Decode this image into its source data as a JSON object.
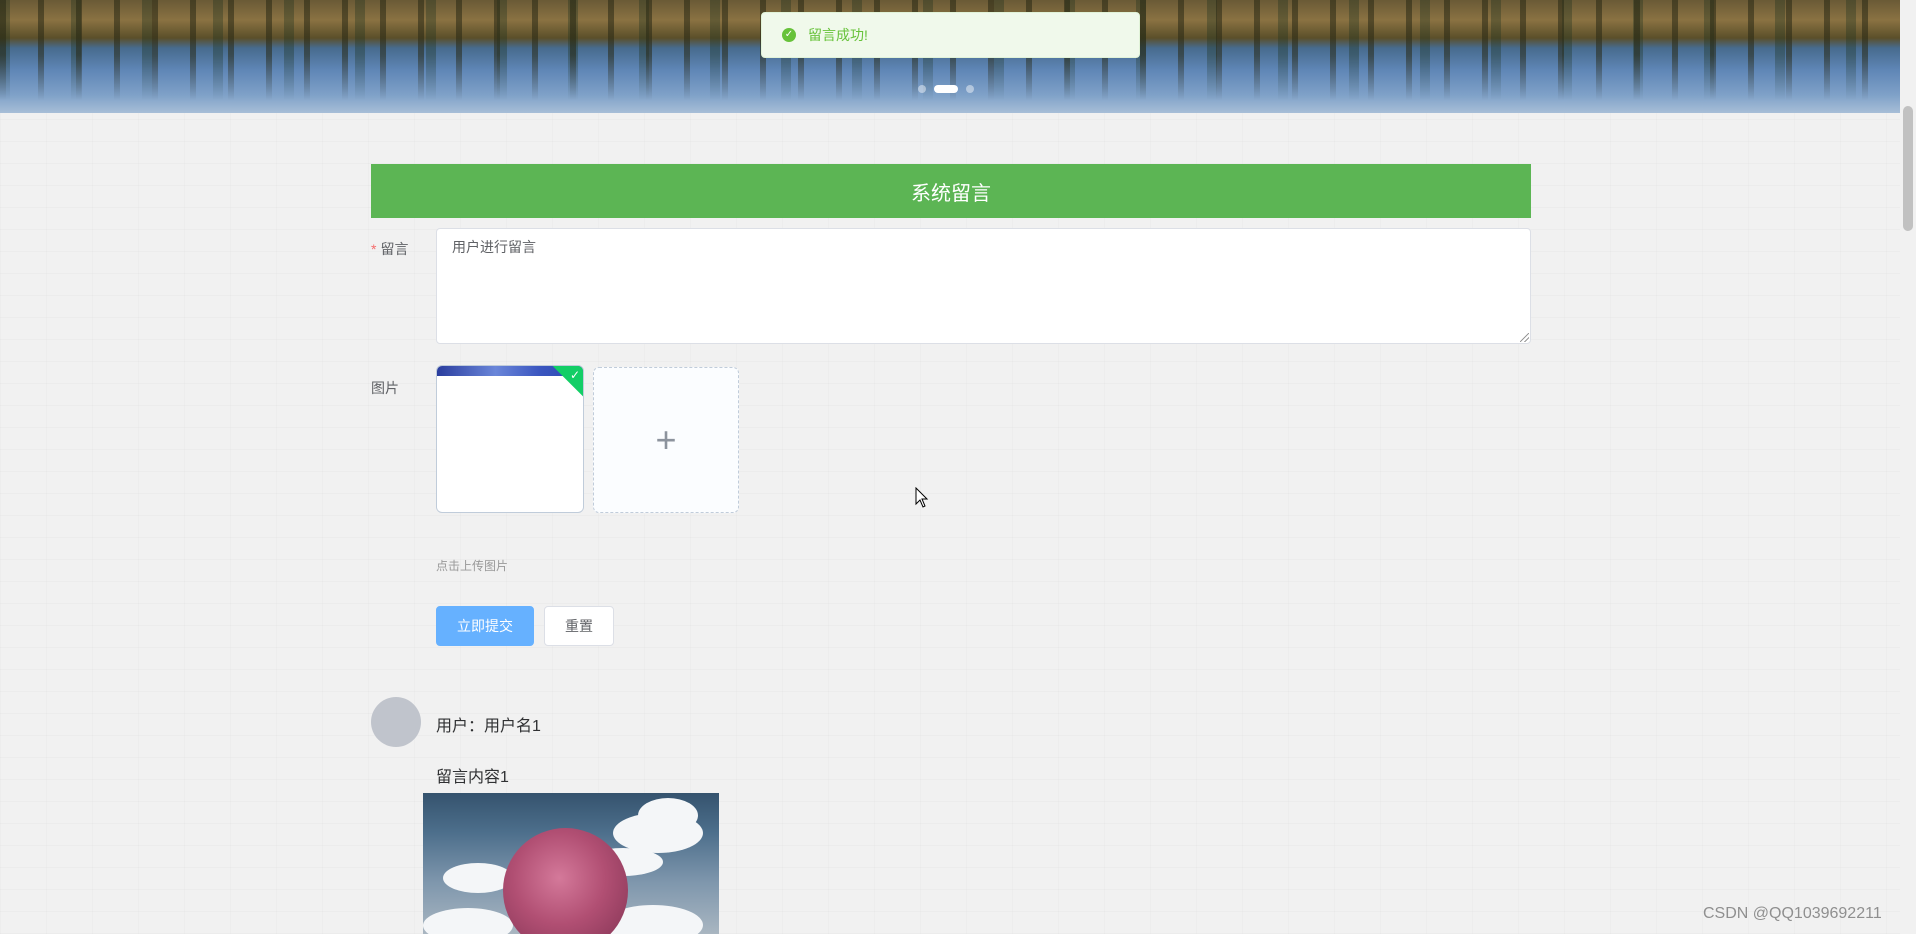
{
  "toast": {
    "icon": "check-circle-icon",
    "message": "留言成功!"
  },
  "carousel": {
    "slides": 3,
    "active_index": 1
  },
  "section": {
    "title": "系统留言"
  },
  "form": {
    "message_label": "留言",
    "message_required_mark": "*",
    "message_value": "用户进行留言",
    "image_label": "图片",
    "upload_tip": "点击上传图片",
    "submit_label": "立即提交",
    "reset_label": "重置"
  },
  "messages": [
    {
      "user_text": "用户：用户名1",
      "content": "留言内容1"
    }
  ],
  "watermark": "CSDN @QQ1039692211",
  "colors": {
    "header_green": "#5cb554",
    "primary": "#66b1ff",
    "success": "#67c23a"
  }
}
